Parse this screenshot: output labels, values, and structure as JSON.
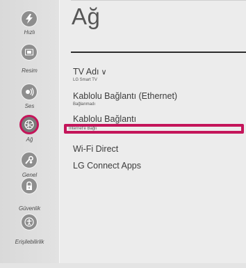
{
  "sidebar": {
    "items": [
      {
        "label": "Hızlı",
        "icon": "lightning-icon",
        "active": false
      },
      {
        "label": "Resim",
        "icon": "picture-icon",
        "active": false
      },
      {
        "label": "Ses",
        "icon": "sound-icon",
        "active": false
      },
      {
        "label": "Ağ",
        "icon": "network-globe-icon",
        "active": true
      },
      {
        "label": "Genel",
        "icon": "wrench-gear-icon",
        "active": false
      },
      {
        "label": "Güvenlik",
        "icon": "lock-icon",
        "active": false
      },
      {
        "label": "Erişilebilirlik",
        "icon": "accessibility-icon",
        "active": false
      }
    ]
  },
  "main": {
    "title": "Ağ",
    "menu": [
      {
        "label": "TV Adı",
        "sub": "LG Smart TV",
        "has_chevron": true
      },
      {
        "label": "Kablolu Bağlantı (Ethernet)",
        "sub": "Bağlanmadı"
      },
      {
        "label": "Kablolu Bağlantı",
        "sub": "İnternet'e Bağlı",
        "highlighted": true
      },
      {
        "label": "Wi-Fi Direct"
      },
      {
        "label": "LG Connect Apps"
      }
    ],
    "chevron": "∨"
  },
  "colors": {
    "accent": "#c4155a",
    "icon_bg": "#8e8e8e"
  }
}
